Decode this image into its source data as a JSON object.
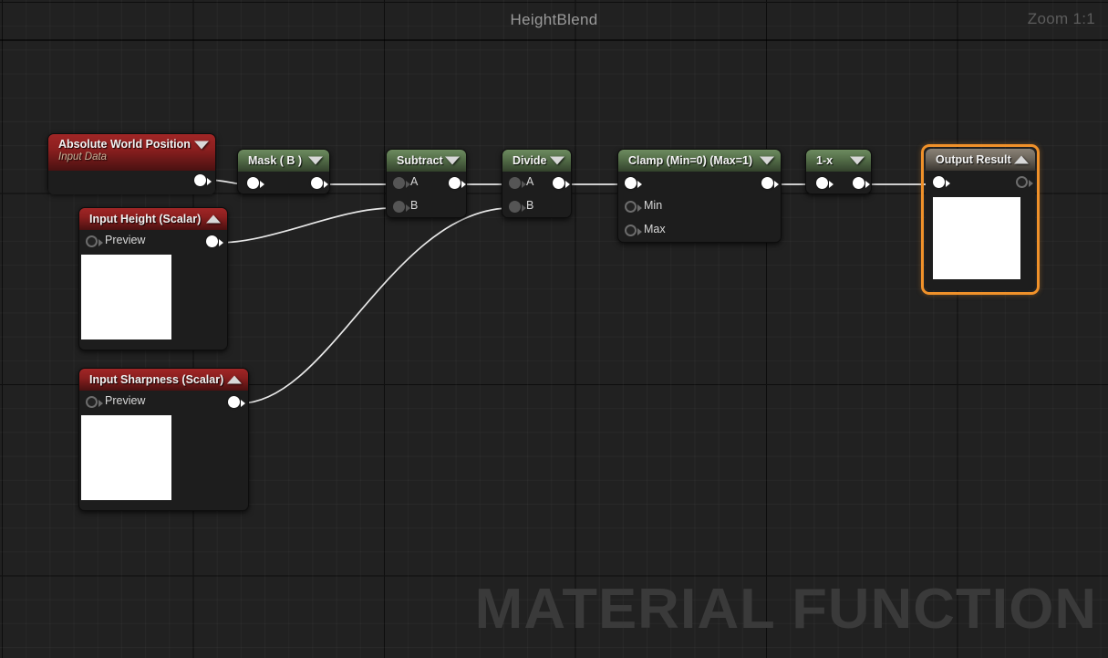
{
  "header": {
    "graph_title": "HeightBlend",
    "zoom_label": "Zoom 1:1"
  },
  "watermark": {
    "text": "MATERIAL FUNCTION"
  },
  "colors": {
    "canvas_bg": "#212121",
    "header_green": "#536d48",
    "header_red": "#8c1f1f",
    "header_gray": "#6d665c",
    "selection_orange": "#f0912a",
    "wire": "#e8e8e8",
    "node_body": "#1d1d1d",
    "title_text": "#9a9a9a"
  },
  "nodes": {
    "absolute_world_position": {
      "title": "Absolute World Position",
      "subtitle": "Input Data",
      "chevron": "chevron-down-icon",
      "output_pin": "output-pin"
    },
    "mask_b": {
      "title": "Mask ( B )",
      "chevron": "chevron-down-icon",
      "input_pin": "input-pin",
      "output_pin": "output-pin"
    },
    "subtract": {
      "title": "Subtract",
      "chevron": "chevron-down-icon",
      "inputs": [
        {
          "label": "A"
        },
        {
          "label": "B"
        }
      ],
      "output_pin": "output-pin"
    },
    "divide": {
      "title": "Divide",
      "chevron": "chevron-down-icon",
      "inputs": [
        {
          "label": "A"
        },
        {
          "label": "B"
        }
      ],
      "output_pin": "output-pin"
    },
    "clamp": {
      "title": "Clamp (Min=0) (Max=1)",
      "chevron": "chevron-down-icon",
      "inputs": [
        {
          "label": ""
        },
        {
          "label": "Min"
        },
        {
          "label": "Max"
        }
      ],
      "output_pin": "output-pin"
    },
    "one_minus_x": {
      "title": "1-x",
      "chevron": "chevron-down-icon",
      "input_pin": "input-pin",
      "output_pin": "output-pin"
    },
    "output_result": {
      "title": "Output Result",
      "chevron": "chevron-up-icon",
      "selected": "true",
      "input_pin": "input-pin",
      "output_pin": "output-pin"
    },
    "input_height": {
      "title": "Input Height (Scalar)",
      "chevron": "chevron-up-icon",
      "preview_label": "Preview",
      "output_pin": "output-pin"
    },
    "input_sharpness": {
      "title": "Input Sharpness (Scalar)",
      "chevron": "chevron-up-icon",
      "preview_label": "Preview",
      "output_pin": "output-pin"
    }
  }
}
